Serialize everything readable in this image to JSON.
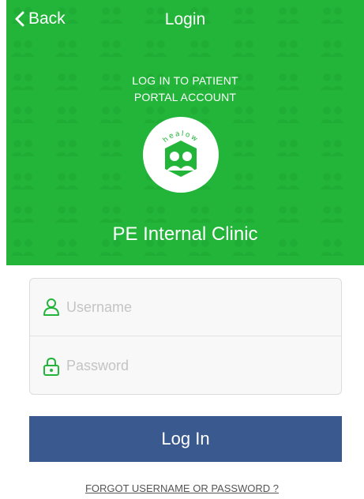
{
  "nav": {
    "back_label": "Back",
    "title": "Login"
  },
  "header": {
    "subtitle_line1": "LOG IN TO PATIENT",
    "subtitle_line2": "PORTAL ACCOUNT",
    "logo_text": "healow",
    "clinic_name": "PE Internal Clinic",
    "bg_color": "#22b53a"
  },
  "form": {
    "username_placeholder": "Username",
    "password_placeholder": "Password",
    "username_icon": "user-icon",
    "password_icon": "lock-icon",
    "icon_color": "#22b53a"
  },
  "actions": {
    "login_label": "Log In",
    "login_color": "#3a5a8f",
    "forgot_label": "FORGOT USERNAME OR PASSWORD ?"
  }
}
